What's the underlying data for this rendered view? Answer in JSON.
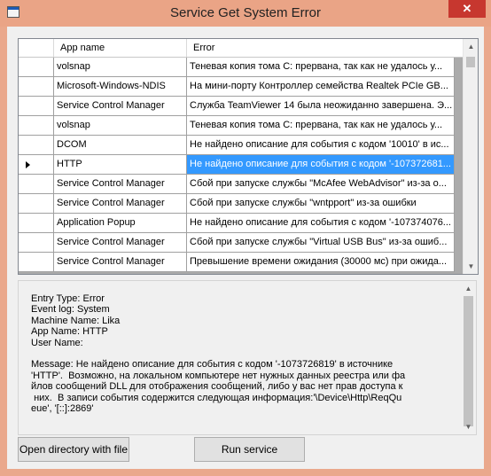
{
  "window": {
    "title": "Service Get System Error",
    "close_glyph": "✕"
  },
  "grid": {
    "columns": [
      "App name",
      "Error"
    ],
    "rows": [
      {
        "app": "volsnap",
        "error": "Теневая копия тома C: прервана, так как не удалось у..."
      },
      {
        "app": "Microsoft-Windows-NDIS",
        "error": "На мини-порту Контроллер семейства Realtek PCIe GB..."
      },
      {
        "app": "Service Control Manager",
        "error": "Служба TeamViewer 14 была неожиданно завершена. Э..."
      },
      {
        "app": "volsnap",
        "error": "Теневая копия тома C: прервана, так как не удалось у..."
      },
      {
        "app": "DCOM",
        "error": "Не найдено описание для события с кодом '10010' в ис..."
      },
      {
        "app": "HTTP",
        "error": "Не найдено описание для события с кодом '-107372681...",
        "selected": true
      },
      {
        "app": "Service Control Manager",
        "error": "Сбой при запуске службы \"McAfee WebAdvisor\" из-за о..."
      },
      {
        "app": "Service Control Manager",
        "error": "Сбой при запуске службы \"wntpport\" из-за ошибки"
      },
      {
        "app": "Application Popup",
        "error": "Не найдено описание для события с кодом '-107374076..."
      },
      {
        "app": "Service Control Manager",
        "error": "Сбой при запуске службы \"Virtual USB Bus\" из-за ошиб..."
      },
      {
        "app": "Service Control Manager",
        "error": "Превышение времени ожидания (30000 мс) при ожида..."
      }
    ]
  },
  "details": {
    "text": "Entry Type: Error\nEvent log: System\nMachine Name: Lika\nApp Name: HTTP\nUser Name:\n\nMessage: Не найдено описание для события с кодом '-1073726819' в источнике\n'HTTP'.  Возможно, на локальном компьютере нет нужных данных реестра или фа\nйлов сообщений DLL для отображения сообщений, либо у вас нет прав доступа к\n них.  В записи события содержится следующая информация:'\\Device\\Http\\ReqQu\neue', '[::]:2869'"
  },
  "buttons": {
    "open_directory": "Open directory with file",
    "run_service": "Run service"
  },
  "scrollbar": {
    "up_glyph": "▲",
    "down_glyph": "▼"
  },
  "colors": {
    "title_bar": "#eaa486",
    "selection": "#3399ff",
    "close_button": "#c7372f"
  }
}
